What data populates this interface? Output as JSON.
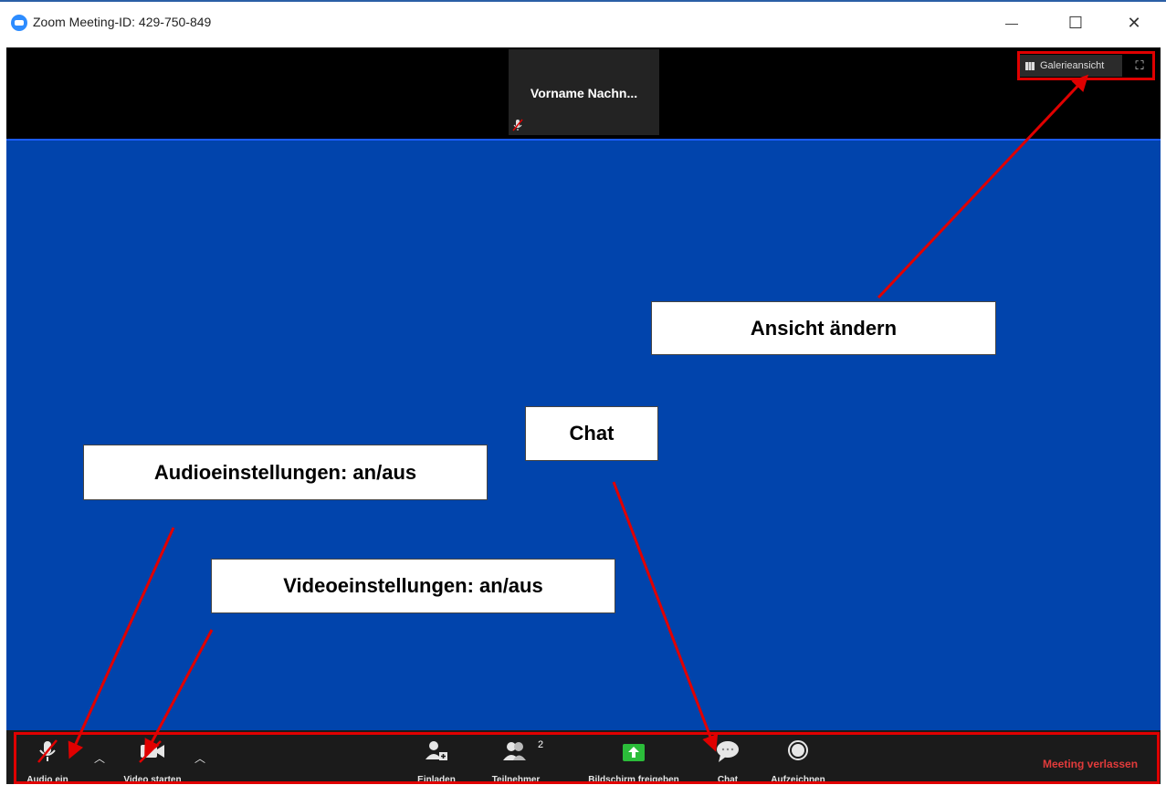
{
  "window": {
    "title": "Zoom Meeting-ID: 429-750-849",
    "minimize_glyph": "—",
    "maximize_glyph": "☐",
    "close_glyph": "✕"
  },
  "video_strip": {
    "participant_name": "Vorname  Nachn...",
    "gallery_label": "Galerieansicht",
    "fullscreen_glyph": "⛶"
  },
  "toolbar": {
    "audio_label": "Audio ein",
    "video_label": "Video starten",
    "invite_label": "Einladen",
    "participants_label": "Teilnehmer",
    "participants_count": "2",
    "share_label": "Bildschirm freigeben",
    "chat_label": "Chat",
    "record_label": "Aufzeichnen",
    "leave_label": "Meeting verlassen",
    "caret_glyph": "︿"
  },
  "callouts": {
    "view": "Ansicht ändern",
    "chat": "Chat",
    "audio": "Audioeinstellungen: an/aus",
    "video": "Videoeinstellungen: an/aus"
  },
  "colors": {
    "stage_blue": "#0144ac",
    "annotation_red": "#e00000",
    "share_green": "#2bbd3a",
    "leave_red": "#e23b3b"
  }
}
